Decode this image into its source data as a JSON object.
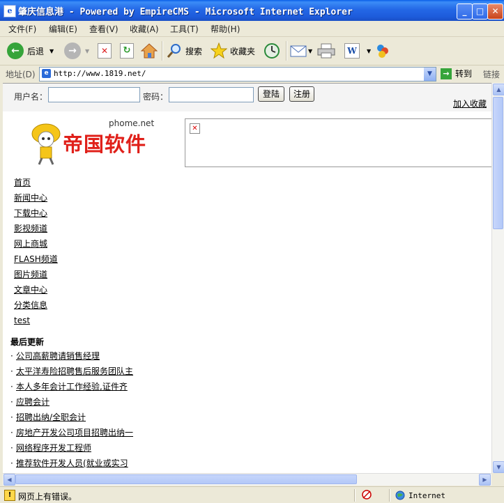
{
  "window": {
    "title": "肇庆信息港 - Powered by EmpireCMS - Microsoft Internet Explorer"
  },
  "menu": [
    "文件(F)",
    "编辑(E)",
    "查看(V)",
    "收藏(A)",
    "工具(T)",
    "帮助(H)"
  ],
  "toolbar": {
    "back": "后退",
    "search": "搜索",
    "favorites": "收藏夹"
  },
  "address": {
    "label": "地址(D)",
    "url": "http://www.1819.net/",
    "go": "转到",
    "links": "链接"
  },
  "login": {
    "username_label": "用户名：",
    "password_label": "密码：",
    "login_button": "登陆",
    "register_button": "注册",
    "add_favorite": "加入收藏"
  },
  "logo": {
    "domain": "phome.net",
    "brand": "帝国软件"
  },
  "nav": [
    "首页",
    "新闻中心",
    "下载中心",
    "影视频道",
    "网上商城",
    "FLASH频道",
    "图片频道",
    "文章中心",
    "分类信息",
    "test"
  ],
  "latest": {
    "title": "最后更新",
    "items": [
      "公司高薪聘请销售经理",
      "太平洋寿险招聘售后服务团队主",
      "本人多年会计工作经验,证件齐",
      "应聘会计",
      "招聘出纳/全职会计",
      "房地产开发公司项目招聘出纳一",
      "网络程序开发工程师",
      "推荐软件开发人员(就业或实习"
    ]
  },
  "status": {
    "message": "网页上有错误。",
    "zone": "Internet"
  },
  "colors": {
    "title_bar": "#2468E6",
    "chrome": "#ECE9D8",
    "logo_red": "#E0201A"
  }
}
